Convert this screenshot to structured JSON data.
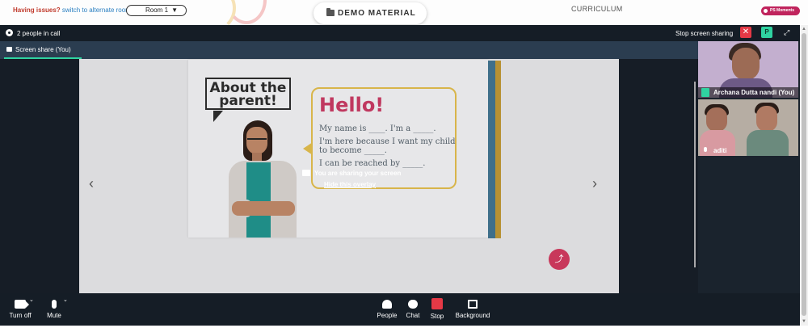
{
  "topbar": {
    "issues_text": "Having issues?",
    "alternate_link": "switch to alternate room",
    "room_select_value": "Room 1",
    "demo_material_label": "DEMO MATERIAL",
    "curriculum_label": "CURRICULUM",
    "moments_label": "PS Moments"
  },
  "call": {
    "people_count": "2 people in call",
    "stop_sharing_label": "Stop screen sharing",
    "close_icon": "close-icon",
    "p_button_label": "P",
    "tab_label": "Screen share (You)",
    "tab_more": "···"
  },
  "slide": {
    "about_title": "About the parent!",
    "hello": "Hello!",
    "lines": [
      "My name is ____. I'm a _____.",
      "I'm here because I want my child to become _____.",
      "I can be reached by _____."
    ]
  },
  "overlay": {
    "sharing_text": "You are sharing your screen",
    "hide_link": "Hide this overlay"
  },
  "participants": [
    {
      "name": "Archana Dutta nandi (You)",
      "mic": "mic-active-icon"
    },
    {
      "name": "aditi",
      "mic": "mic-icon"
    }
  ],
  "toolbar": {
    "turn_off_label": "Turn off",
    "mute_label": "Mute",
    "people_label": "People",
    "chat_label": "Chat",
    "stop_label": "Stop",
    "background_label": "Background"
  },
  "colors": {
    "accent_green": "#2fd3a1",
    "stop_red": "#e53946",
    "brand_pink": "#c8385b"
  }
}
